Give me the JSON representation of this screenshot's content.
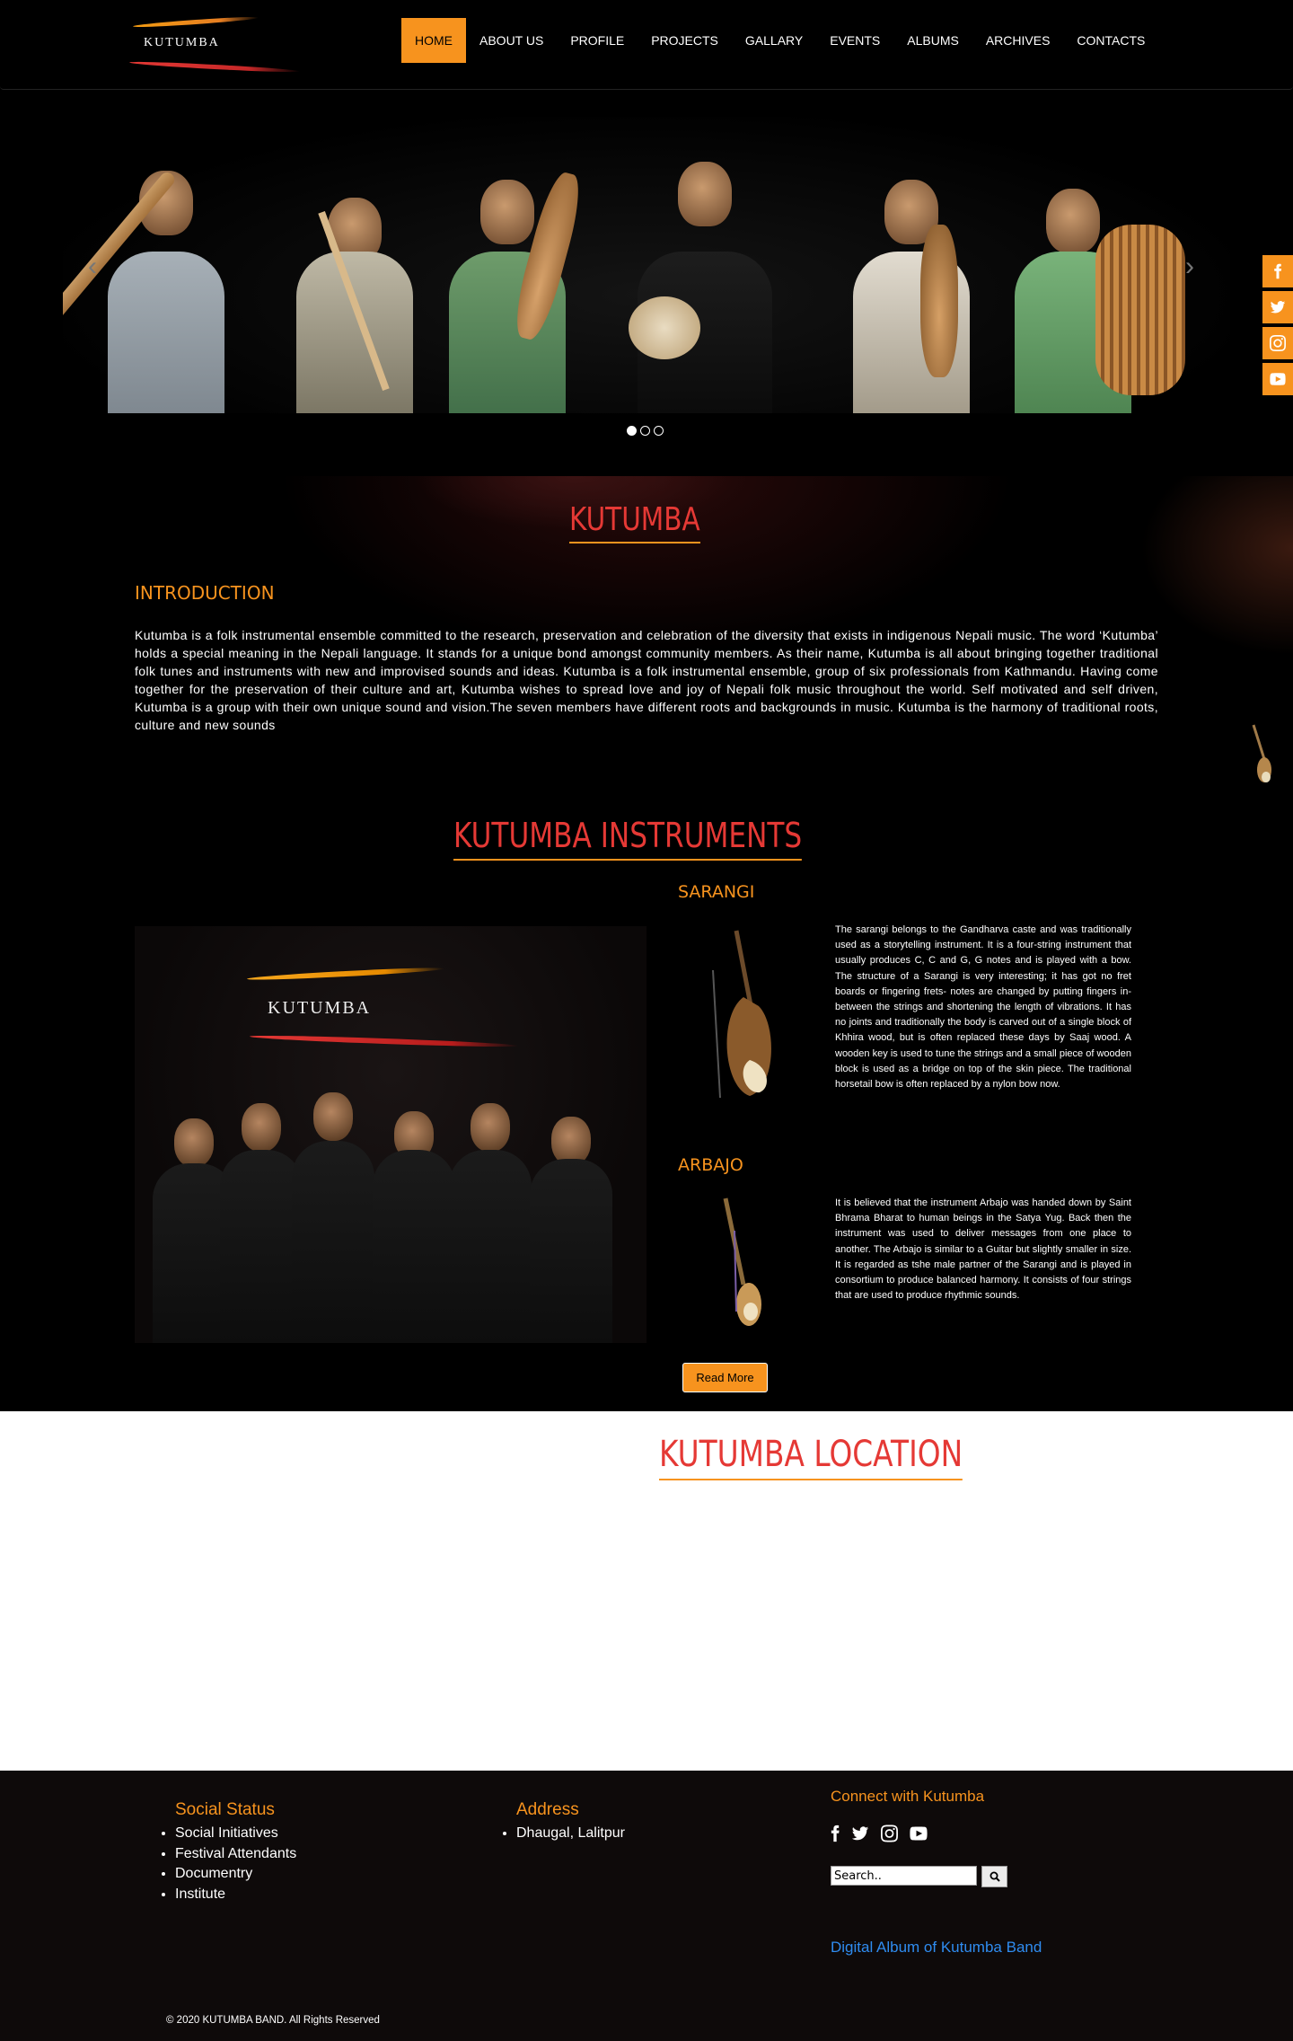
{
  "header": {
    "logo_text": "KUTUMBA",
    "nav": [
      "HOME",
      "ABOUT US",
      "PROFILE",
      "PROJECTS",
      "GALLARY",
      "EVENTS",
      "ALBUMS",
      "ARCHIVES",
      "CONTACTS"
    ],
    "active_nav": "HOME"
  },
  "social_sidebar": [
    "facebook-icon",
    "twitter-icon",
    "instagram-icon",
    "youtube-icon"
  ],
  "slider": {
    "slide_count": 3,
    "active_slide": 1,
    "prev_arrow": "‹",
    "next_arrow": "›"
  },
  "intro": {
    "title": "KUTUMBA",
    "heading": "INTRODUCTION",
    "text": "Kutumba is a folk instrumental ensemble committed to the research, preservation and celebration of the diversity that exists in indigenous Nepali music. The word ‘Kutumba’ holds a special meaning in the Nepali language. It stands for a unique bond amongst community members. As their name, Kutumba is all about bringing together traditional folk tunes and instruments with new and improvised sounds and ideas. Kutumba is a folk instrumental ensemble, group of six professionals from Kathmandu. Having come together for the preservation of their culture and art, Kutumba wishes to spread love and joy of Nepali folk music throughout the world. Self motivated and self driven, Kutumba is a group with their own unique sound and vision.The seven members have different roots and backgrounds in music. Kutumba is the harmony of traditional roots, culture and new sounds"
  },
  "instruments": {
    "title": "KUTUMBA INSTRUMENTS",
    "group_photo_text": "KUTUMBA",
    "items": [
      {
        "name": "SARANGI",
        "description": "The sarangi belongs to the Gandharva caste and was traditionally used as a storytelling instrument. It is a four-string instrument that usually produces C, C and G, G notes and is played with a bow. The structure of a Sarangi is very interesting; it has got no fret boards or fingering frets- notes are changed by putting fingers in-between the strings and shortening the length of vibrations. It has no joints and traditionally the body is carved out of a single block of Khhira wood, but is often replaced these days by Saaj wood. A wooden key is used to tune the strings and a small piece of wooden block is used as a bridge on top of the skin piece. The traditional horsetail bow is often replaced by a nylon bow now."
      },
      {
        "name": "ARBAJO",
        "description": "It is believed that the instrument Arbajo was handed down by Saint Bhrama Bharat to human beings in the Satya Yug. Back then the instrument was used to deliver messages from one place to another. The Arbajo is similar to a Guitar but slightly smaller in size. It is regarded as tshe male partner of the Sarangi and is played in consortium to produce balanced harmony. It consists of four strings that are used to produce rhythmic sounds."
      }
    ],
    "read_more": "Read More"
  },
  "location": {
    "title": "KUTUMBA LOCATION"
  },
  "footer": {
    "social_status": {
      "heading": "Social Status",
      "items": [
        "Social Initiatives",
        "Festival Attendants",
        "Documentry",
        "Institute"
      ]
    },
    "address": {
      "heading": "Address",
      "items": [
        "Dhaugal, Lalitpur"
      ]
    },
    "connect": {
      "heading": "Connect with Kutumba",
      "icons": [
        "facebook-icon",
        "twitter-icon",
        "instagram-icon",
        "youtube-icon"
      ],
      "search_value": "Search..",
      "album_link": "Digital Album of Kutumba Band"
    },
    "copyright": "© 2020 KUTUMBA BAND. All Rights Reserved"
  },
  "colors": {
    "accent": "#f7931e",
    "title_red": "#e53935",
    "link_blue": "#2f8cf0",
    "footer_bg": "#0e0a0a"
  }
}
